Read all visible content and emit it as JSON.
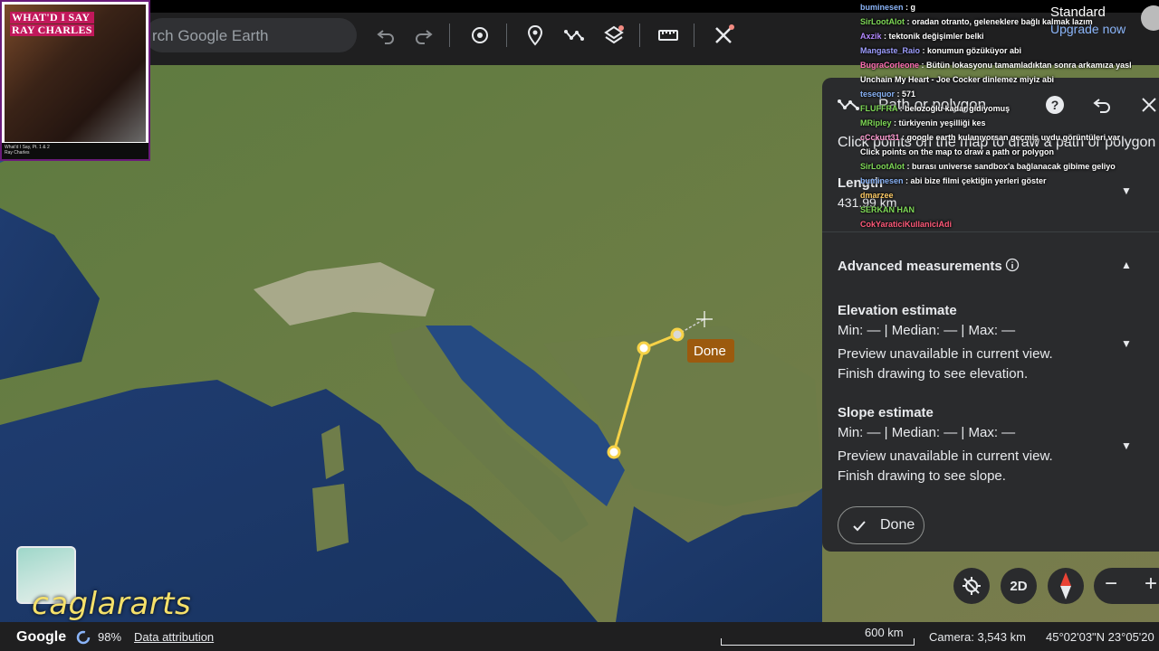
{
  "app": {
    "search": {
      "placeholder": "rch Google Earth"
    },
    "toolbar": {
      "icons": [
        "undo-icon",
        "redo-icon",
        "history-icon",
        "placemark-icon",
        "path-icon",
        "layers-icon",
        "ruler-icon",
        "tools-icon"
      ]
    },
    "account": {
      "plan_label": "Standard",
      "upgrade_label": "Upgrade now"
    }
  },
  "album": {
    "title_line1": "WHAT'D I SAY",
    "title_line2": "RAY CHARLES",
    "foot_line1": "What'd I Say, Pt. 1 & 2",
    "foot_line2": "Ray Charles"
  },
  "chat": [
    {
      "user": "buminesen",
      "text": "g",
      "color": "#8ab4f8"
    },
    {
      "user": "SirLootAlot",
      "text": "oradan otranto, geleneklere bağlı kalmak lazım",
      "color": "#7fd957"
    },
    {
      "user": "Axzik",
      "text": "tektonik değişimler belki",
      "color": "#b388ff"
    },
    {
      "user": "Mangaste_Raio",
      "text": "konumun gözüküyor abi",
      "color": "#9e9eff"
    },
    {
      "user": "BugraCorleone",
      "text": "Bütün lokasyonu tamamladıktan sonra arkamıza yaslanıp",
      "color": "#ff6fb5"
    },
    {
      "user": "",
      "text": "Unchain My Heart - Joe Cocker dinlemez miyiz abi",
      "color": "#ffffff"
    },
    {
      "user": "tesequor",
      "text": "571",
      "color": "#8ab4f8"
    },
    {
      "user": "FLUFFRA",
      "text": "belozoğlu kadar gidiyomuş",
      "color": "#7fd957"
    },
    {
      "user": "MRipley",
      "text": "türkiyenin yeşilliği kes",
      "color": "#7fd957"
    },
    {
      "user": "cCckurt31",
      "text": "google earth kulanıyorsan geçmiş uydu görüntüleri var",
      "color": "#ff9bd2"
    },
    {
      "user": "",
      "text": "Click points on the map to draw a path or polygon",
      "color": "#ffffff"
    },
    {
      "user": "SirLootAlot",
      "text": "burası universe sandbox'a bağlanacak gibime geliyo",
      "color": "#7fd957"
    },
    {
      "user": "buminesen",
      "text": "abi bize filmi çektiğin yerleri göster",
      "color": "#8ab4f8"
    },
    {
      "user": "dmarzee",
      "text": "",
      "color": "#ffcc66"
    },
    {
      "user": "SERKAN HAN",
      "text": "",
      "color": "#7fd957"
    },
    {
      "user": "CokYaraticiKullaniciAdi",
      "text": "",
      "color": "#ff5a7a"
    }
  ],
  "panel": {
    "title": "Path or polygon",
    "hint": "Click points on the map to draw a path or polygon",
    "length_label": "Length",
    "length_value": "431.99 km",
    "advanced_label": "Advanced measurements",
    "elevation": {
      "title": "Elevation estimate",
      "stats": "Min: — | Median: — | Max: —",
      "note_line1": "Preview unavailable in current view.",
      "note_line2": "Finish drawing to see elevation."
    },
    "slope": {
      "title": "Slope estimate",
      "stats": "Min: — | Median: — | Max: —",
      "note_line1": "Preview unavailable in current view.",
      "note_line2": "Finish drawing to see slope."
    },
    "done_label": "Done"
  },
  "map": {
    "done_tag": "Done",
    "path_color": "#f6d247"
  },
  "status": {
    "brand": "Google",
    "loading": "98%",
    "attribution": "Data attribution",
    "scale": "600 km",
    "camera": "Camera: 3,543 km",
    "coords": "45°02'03\"N 23°05'20"
  },
  "controls": {
    "view_mode": "2D"
  },
  "watermark": "caglararts"
}
